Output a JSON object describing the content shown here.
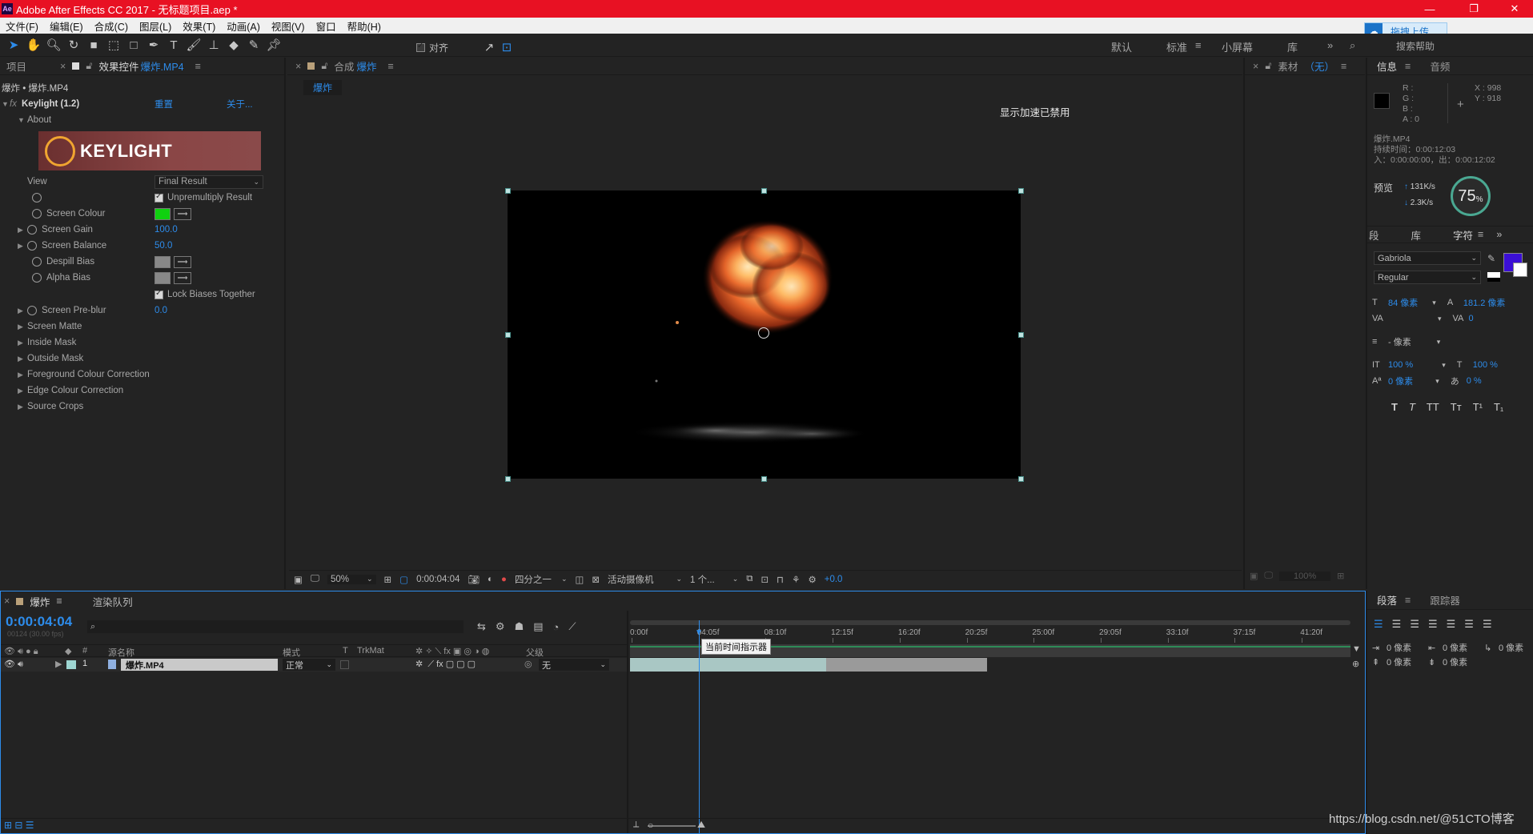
{
  "window": {
    "title": "Adobe After Effects CC 2017 - 无标题项目.aep *",
    "upload_button": "拖拽上传",
    "search_help": "搜索帮助"
  },
  "menu": [
    "文件(F)",
    "编辑(E)",
    "合成(C)",
    "图层(L)",
    "效果(T)",
    "动画(A)",
    "视图(V)",
    "窗口",
    "帮助(H)"
  ],
  "toolbar": {
    "align_label": "对齐",
    "workspaces": [
      "默认",
      "标准",
      "小屏幕",
      "库"
    ],
    "active_workspace": "标准"
  },
  "effect_controls": {
    "tab_project": "项目",
    "tab_label": "效果控件",
    "tab_layer": "爆炸.MP4",
    "breadcrumb": "爆炸 • 爆炸.MP4",
    "effect_name": "Keylight (1.2)",
    "reset": "重置",
    "about_link": "关于...",
    "about": "About",
    "logo_text": "KEYLIGHT",
    "view_label": "View",
    "view_value": "Final Result",
    "unpremultiply": "Unpremultiply Result",
    "screen_colour": "Screen Colour",
    "screen_gain": "Screen Gain",
    "screen_gain_value": "100.0",
    "screen_balance": "Screen Balance",
    "screen_balance_value": "50.0",
    "despill_bias": "Despill Bias",
    "alpha_bias": "Alpha Bias",
    "lock_biases": "Lock Biases Together",
    "screen_preblur": "Screen Pre-blur",
    "screen_preblur_value": "0.0",
    "groups": [
      "Screen Matte",
      "Inside Mask",
      "Outside Mask",
      "Foreground Colour Correction",
      "Edge Colour Correction",
      "Source Crops"
    ],
    "screen_colour_hex": "#0fd10f"
  },
  "composition": {
    "tab_prefix": "合成",
    "tab_name": "爆炸",
    "comp_chip": "爆炸",
    "gpu_notice": "显示加速已禁用",
    "zoom": "50%",
    "timecode": "0:00:04:04",
    "resolution": "四分之一",
    "camera": "活动摄像机",
    "views": "1 个...",
    "exposure": "+0.0"
  },
  "footage": {
    "tab_label": "素材",
    "tab_value": "（无）",
    "zoom": "100%"
  },
  "info": {
    "tab_info": "信息",
    "tab_audio": "音频",
    "r": "R :",
    "g": "G :",
    "b": "B :",
    "a": "A : 0",
    "x": "X : 998",
    "y": "Y : 918",
    "clip_name": "爆炸.MP4",
    "duration": "持续时间：0:00:12:03",
    "in_out": "入：0:00:00:00，出：0:00:12:02",
    "preview_label": "预览",
    "speed_up": "131K/s",
    "speed_down": "2.3K/s",
    "percent": "75",
    "percent_unit": "%"
  },
  "character": {
    "tab_segment": "段",
    "tab_library": "库",
    "tab_character": "字符",
    "font": "Gabriola",
    "style": "Regular",
    "size": "84 像素",
    "leading": "181.2 像素",
    "kerning": "",
    "tracking": "0",
    "stroke": "- 像素",
    "vscale": "100 %",
    "hscale": "100 %",
    "baseline": "0 像素",
    "tsume": "0 %",
    "fill_color": "#3b0fd6",
    "style_buttons": [
      "T",
      "T",
      "TT",
      "Tт",
      "T¹",
      "T₁"
    ]
  },
  "timeline": {
    "tab_comp": "爆炸",
    "tab_render": "渲染队列",
    "timecode": "0:00:04:04",
    "fps": "00124 (30.00 fps)",
    "columns": {
      "layer_name": "源名称",
      "mode": "模式",
      "t": "T",
      "trkmat": "TrkMat",
      "parent": "父级",
      "num": "#"
    },
    "layer": {
      "index": "1",
      "name": "爆炸.MP4",
      "mode": "正常",
      "parent": "无"
    },
    "ruler_labels": [
      "0:00f",
      "04:05f",
      "08:10f",
      "12:15f",
      "16:20f",
      "20:25f",
      "25:00f",
      "29:05f",
      "33:10f",
      "37:15f",
      "41:20f"
    ],
    "tooltip": "当前时间指示器"
  },
  "paragraph": {
    "tab_para": "段落",
    "tab_tracker": "跟踪器",
    "indent_left": "0 像素",
    "indent_right": "0 像素",
    "first_line": "0 像素",
    "space_before": "0 像素",
    "space_after": "0 像素",
    "space_after2": "0 像素"
  },
  "watermark": "https://blog.csdn.net/@51CTO博客"
}
